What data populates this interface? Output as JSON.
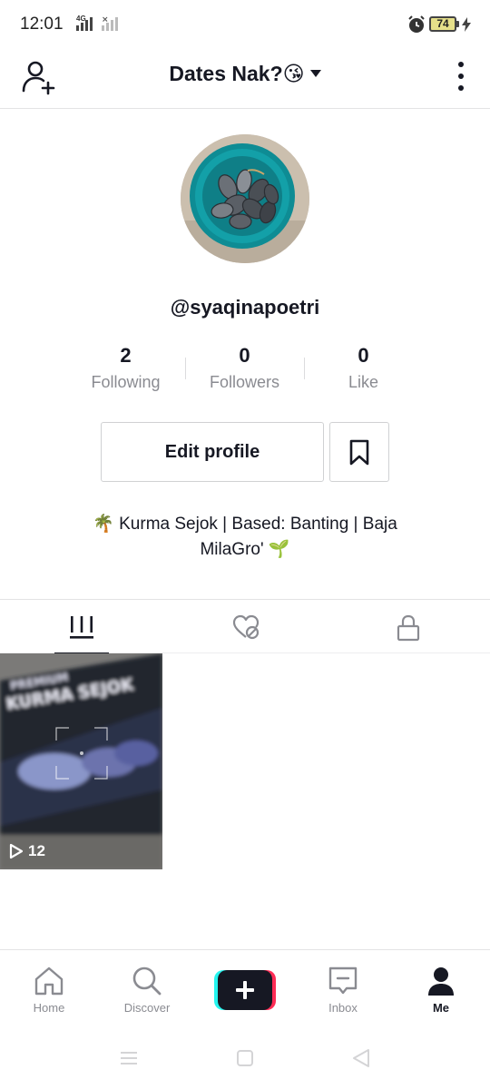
{
  "status_bar": {
    "time": "12:01",
    "network": "4G",
    "battery": "74"
  },
  "header": {
    "title": "Dates Nak?😘"
  },
  "profile": {
    "username": "@syaqinapoetri",
    "stats": [
      {
        "count": "2",
        "label": "Following"
      },
      {
        "count": "0",
        "label": "Followers"
      },
      {
        "count": "0",
        "label": "Like"
      }
    ],
    "edit_profile_label": "Edit profile",
    "bio_line1": "🌴 Kurma Sejok | Based: Banting | Baja",
    "bio_line2": "MilaGro' 🌱"
  },
  "videos": [
    {
      "views": "12"
    }
  ],
  "bottom_nav": {
    "items": [
      {
        "label": "Home"
      },
      {
        "label": "Discover"
      },
      {
        "label": "Inbox"
      },
      {
        "label": "Me"
      }
    ]
  },
  "colors": {
    "text": "#161823",
    "secondary": "#8a8b91",
    "create_cyan": "#25f4ee",
    "create_red": "#fe2c55"
  }
}
